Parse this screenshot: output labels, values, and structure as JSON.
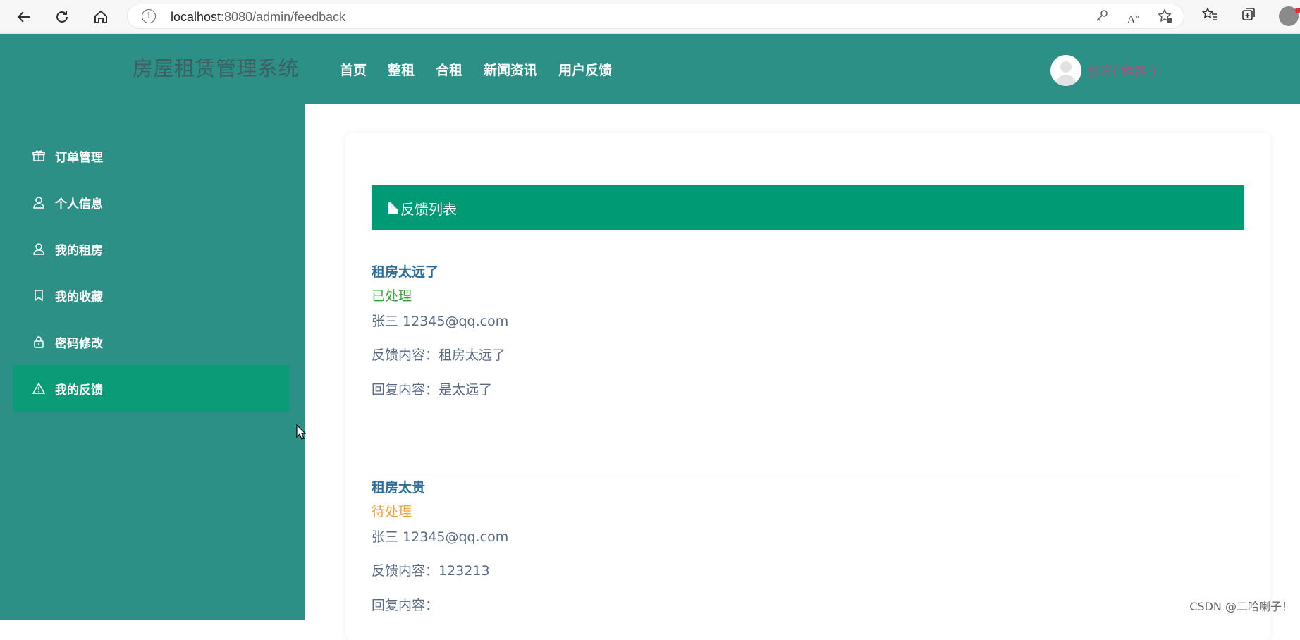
{
  "browser": {
    "url_host": "localhost",
    "url_path": ":8080/admin/feedback",
    "icons": {
      "back": "back-arrow-icon",
      "reload": "reload-icon",
      "home": "home-icon",
      "info": "info-icon",
      "key": "key-icon",
      "read_aloud": "read-aloud-icon",
      "favorite": "add-favorite-icon",
      "favorites": "favorites-icon",
      "collections": "collections-icon",
      "profile": "profile-icon"
    }
  },
  "header": {
    "brand": "房屋租赁管理系统",
    "nav": [
      "首页",
      "整租",
      "合租",
      "新闻资讯",
      "用户反馈"
    ],
    "user_name": "张三( 租客 )"
  },
  "sidebar": {
    "items": [
      {
        "label": "订单管理",
        "icon": "gift-icon",
        "active": false
      },
      {
        "label": "个人信息",
        "icon": "user-icon",
        "active": false
      },
      {
        "label": "我的租房",
        "icon": "user-icon",
        "active": false
      },
      {
        "label": "我的收藏",
        "icon": "bookmark-icon",
        "active": false
      },
      {
        "label": "密码修改",
        "icon": "lock-icon",
        "active": false
      },
      {
        "label": "我的反馈",
        "icon": "warning-icon",
        "active": true
      }
    ]
  },
  "main": {
    "list_title": "反馈列表",
    "feedbacks": [
      {
        "title": "租房太远了",
        "status": "已处理",
        "user_line": "张三 12345@qq.com",
        "content_line": "反馈内容：租房太远了",
        "reply_line": "回复内容：是太远了"
      },
      {
        "title": "租房太贵",
        "status": "待处理",
        "user_line": "张三 12345@qq.com",
        "content_line": "反馈内容：123213",
        "reply_line": "回复内容："
      }
    ]
  },
  "watermark": "CSDN @二哈喇子！",
  "colors": {
    "header_bg": "#2d9086",
    "active_menu": "#0b9b76",
    "list_header": "#009a74",
    "title_blue": "#2b6e9a",
    "status_done": "#3aa139",
    "status_pending": "#f0a03a"
  }
}
